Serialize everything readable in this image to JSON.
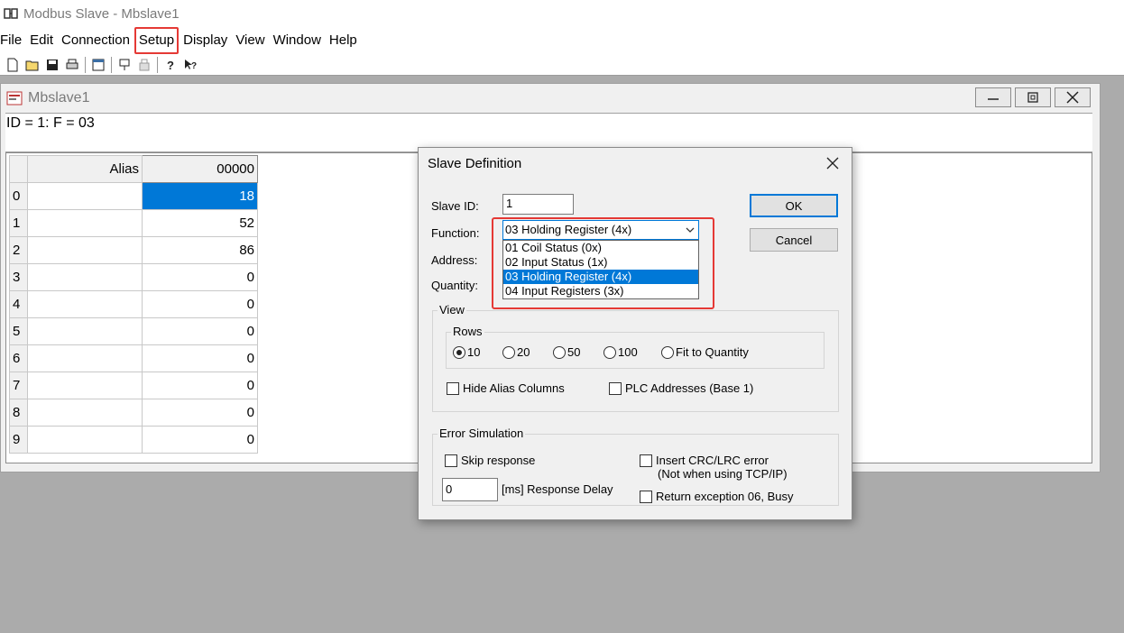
{
  "app": {
    "title": "Modbus Slave - Mbslave1"
  },
  "menu": [
    "File",
    "Edit",
    "Connection",
    "Setup",
    "Display",
    "View",
    "Window",
    "Help"
  ],
  "child": {
    "title": "Mbslave1",
    "header": "ID = 1: F = 03",
    "grid": {
      "col_alias": "Alias",
      "col_address": "00000",
      "rows": [
        {
          "index": "0",
          "value": "18"
        },
        {
          "index": "1",
          "value": "52"
        },
        {
          "index": "2",
          "value": "86"
        },
        {
          "index": "3",
          "value": "0"
        },
        {
          "index": "4",
          "value": "0"
        },
        {
          "index": "5",
          "value": "0"
        },
        {
          "index": "6",
          "value": "0"
        },
        {
          "index": "7",
          "value": "0"
        },
        {
          "index": "8",
          "value": "0"
        },
        {
          "index": "9",
          "value": "0"
        }
      ]
    }
  },
  "dialog": {
    "title": "Slave Definition",
    "slave_id_label": "Slave ID:",
    "slave_id_value": "1",
    "function_label": "Function:",
    "function_value": "03 Holding Register (4x)",
    "function_options": [
      "01 Coil Status (0x)",
      "02 Input Status (1x)",
      "03 Holding Register (4x)",
      "04 Input Registers (3x)"
    ],
    "address_label": "Address:",
    "quantity_label": "Quantity:",
    "ok": "OK",
    "cancel": "Cancel",
    "view_label": "View",
    "rows_label": "Rows",
    "rows_options": [
      "10",
      "20",
      "50",
      "100",
      "Fit to Quantity"
    ],
    "hide_alias": "Hide Alias Columns",
    "plc_addresses": "PLC Addresses (Base 1)",
    "error_sim_label": "Error Simulation",
    "skip_response": "Skip response",
    "insert_crc": "Insert CRC/LRC error",
    "insert_crc_note": "(Not when using TCP/IP)",
    "delay_value": "0",
    "delay_label": "[ms] Response Delay",
    "return_exception": "Return exception 06, Busy"
  },
  "colors": {
    "highlight": "#0078d7",
    "annotation": "#e53935"
  }
}
